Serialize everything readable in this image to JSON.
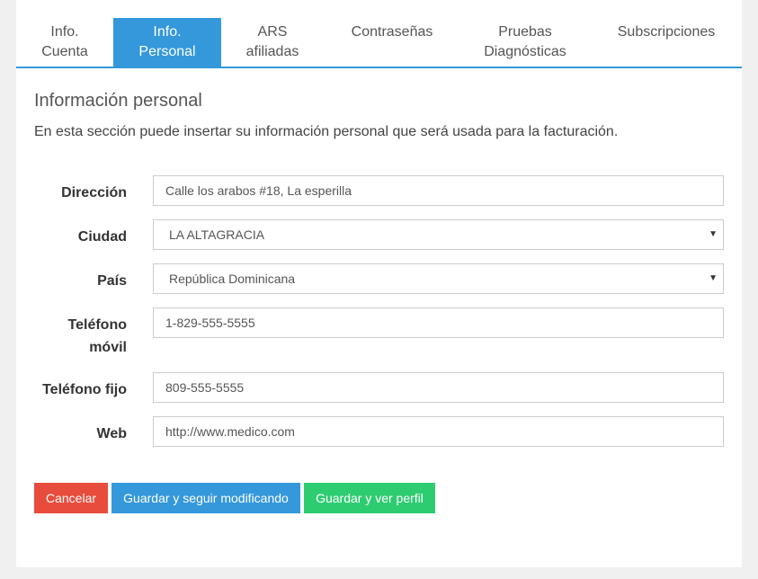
{
  "tabs": [
    {
      "line1": "Info.",
      "line2": "Cuenta"
    },
    {
      "line1": "Info.",
      "line2": "Personal"
    },
    {
      "line1": "ARS",
      "line2": "afiliadas"
    },
    {
      "line1": "Contraseñas",
      "line2": ""
    },
    {
      "line1": "Pruebas",
      "line2": "Diagnósticas"
    },
    {
      "line1": "Subscripciones",
      "line2": ""
    }
  ],
  "section": {
    "title": "Información personal",
    "description": "En esta sección puede insertar su información personal que será usada para la facturación."
  },
  "form": {
    "direccion": {
      "label": "Dirección",
      "value": "Calle los arabos #18, La esperilla"
    },
    "ciudad": {
      "label": "Ciudad",
      "value": "LA ALTAGRACIA"
    },
    "pais": {
      "label": "País",
      "value": "República Dominicana"
    },
    "telefono_movil": {
      "label_line1": "Teléfono",
      "label_line2": "móvil",
      "value": "1-829-555-5555"
    },
    "telefono_fijo": {
      "label": "Teléfono fijo",
      "value": "809-555-5555"
    },
    "web": {
      "label": "Web",
      "value": "http://www.medico.com"
    }
  },
  "buttons": {
    "cancel": "Cancelar",
    "save_continue": "Guardar y seguir modificando",
    "save_view": "Guardar y ver perfil"
  },
  "colors": {
    "primary": "#3498db",
    "danger": "#e74c3c",
    "success": "#2ecc71"
  }
}
